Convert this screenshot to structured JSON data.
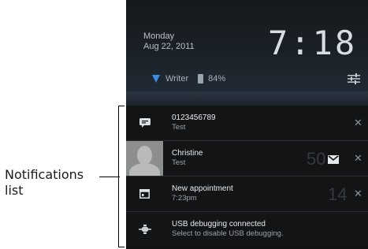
{
  "callout": {
    "label_line1": "Notifications",
    "label_line2": "list"
  },
  "lockscreen": {
    "day": "Monday",
    "date": "Aug 22, 2011",
    "time": "7:18",
    "network": "Writer",
    "battery": "84%"
  },
  "notifications": [
    {
      "title": "0123456789",
      "subtitle": "Test",
      "icon": "message-icon"
    },
    {
      "title": "Christine",
      "subtitle": "Test",
      "icon": "contact-avatar",
      "count": "50",
      "badge_icon": "gmail-icon"
    },
    {
      "title": "New appointment",
      "subtitle": "7:23pm",
      "icon": "calendar-icon",
      "count": "14"
    },
    {
      "title": "USB debugging connected",
      "subtitle": "Select to disable USB debugging.",
      "icon": "usb-icon"
    }
  ],
  "colors": {
    "wifi_accent": "#3a8de0",
    "panel_bg": "#101214"
  }
}
